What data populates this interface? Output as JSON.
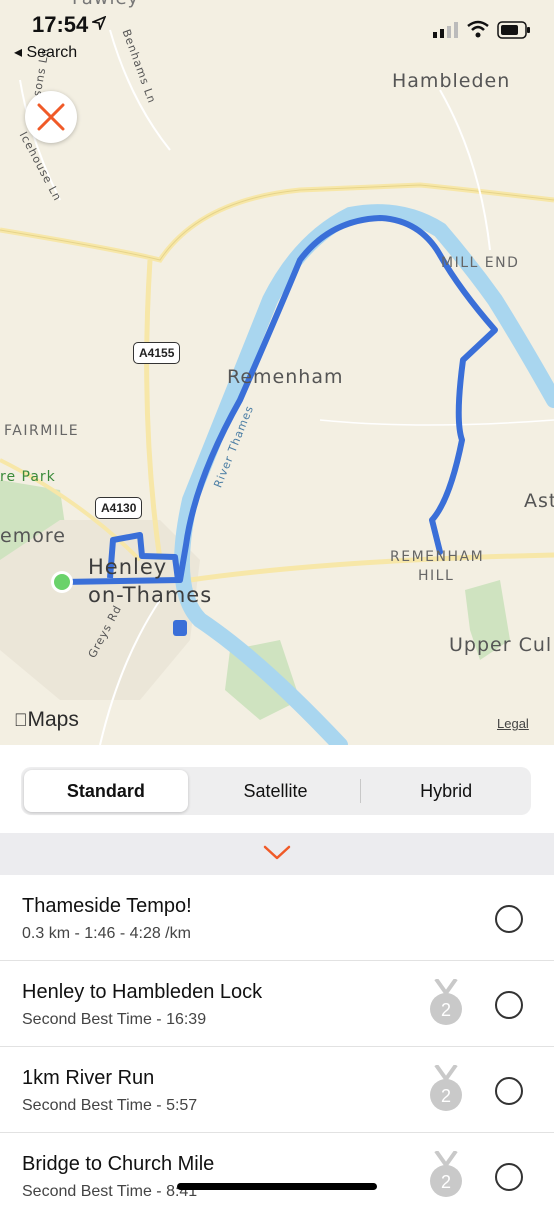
{
  "status_bar": {
    "time": "17:54",
    "back_label": "◂ Search"
  },
  "map": {
    "labels": {
      "hambleden": "Hambleden",
      "mill_end": "MILL END",
      "remenham": "Remenham",
      "fairmile": "FAIRMILE",
      "re_park": "re Park",
      "emore": "emore",
      "henley_1": "Henley",
      "henley_2": "on-Thames",
      "remenham_hill_1": "REMENHAM",
      "remenham_hill_2": "HILL",
      "upper_cul": "Upper Cul",
      "ast": "Ast",
      "river_thames": "River Thames",
      "greys_rd": "Greys Rd",
      "icehouse_ln": "Icehouse Ln",
      "dobsons_ln": "Dobsons Ln",
      "benhams_ln": "Benhams Ln",
      "fawley": "Fawley"
    },
    "shields": {
      "a4155": "A4155",
      "a4130": "A4130"
    },
    "logo": "Maps",
    "legal": "Legal"
  },
  "map_type": {
    "options": [
      "Standard",
      "Satellite",
      "Hybrid"
    ],
    "selected": "Standard"
  },
  "colors": {
    "accent": "#f05a28",
    "route": "#3a6fd8",
    "river": "#a9d6ef"
  },
  "segments": [
    {
      "title": "Thameside Tempo!",
      "subtitle": "0.3 km - 1:46 - 4:28 /km",
      "medal": ""
    },
    {
      "title": "Henley to Hambleden Lock",
      "subtitle": "Second Best Time - 16:39",
      "medal": "2"
    },
    {
      "title": "1km River Run",
      "subtitle": "Second Best Time - 5:57",
      "medal": "2"
    },
    {
      "title": "Bridge to Church Mile",
      "subtitle": "Second Best Time - 8:41",
      "medal": "2"
    }
  ]
}
